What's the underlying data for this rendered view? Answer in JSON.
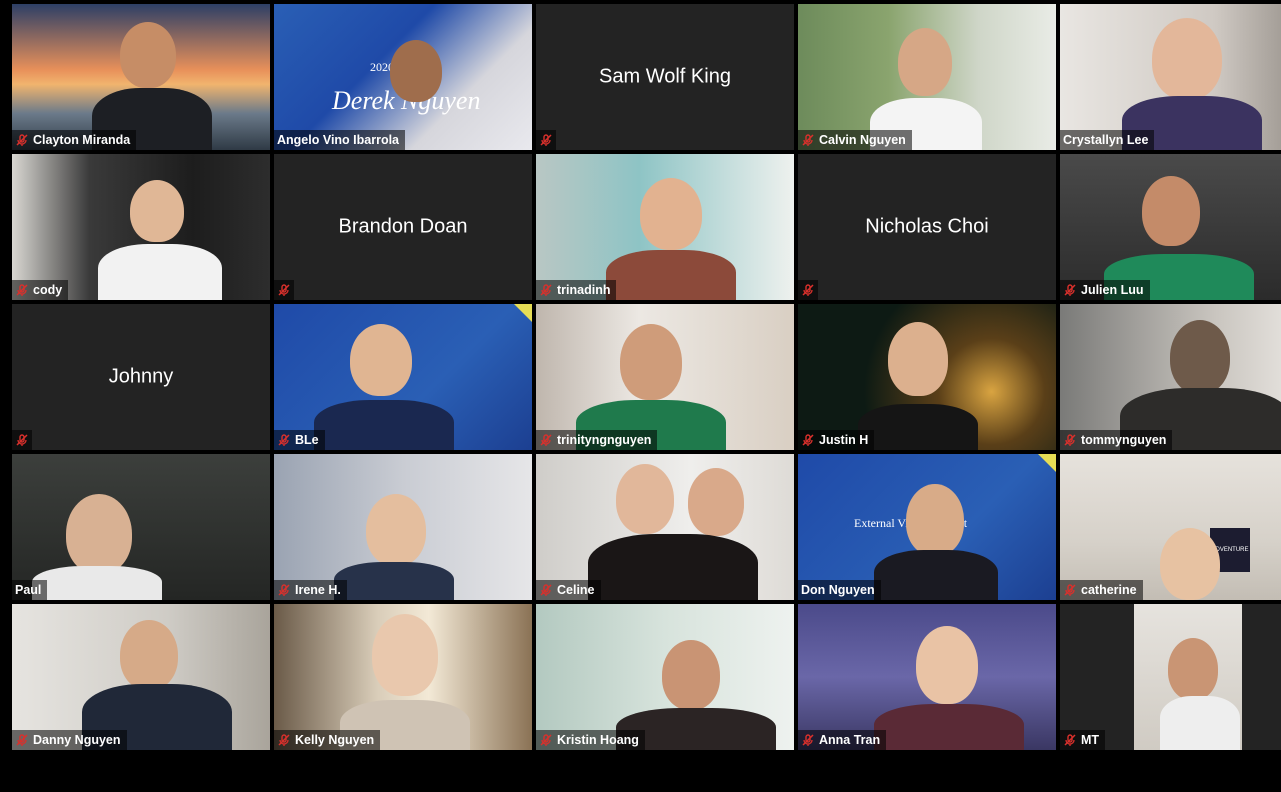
{
  "participants": [
    {
      "name": "Clayton Miranda",
      "video": true
    },
    {
      "name": "Angelo Vino Ibarrola",
      "video": true,
      "active": true
    },
    {
      "name": "Sam Wolf King",
      "video": false
    },
    {
      "name": "Calvin Nguyen",
      "video": true
    },
    {
      "name": "Crystallyn Lee",
      "video": true
    },
    {
      "name": "cody",
      "video": true
    },
    {
      "name": "Brandon Doan",
      "video": false
    },
    {
      "name": "trinadinh",
      "video": true
    },
    {
      "name": "Nicholas Choi",
      "video": false
    },
    {
      "name": "Julien Luu",
      "video": true
    },
    {
      "name": "Johnny",
      "video": false
    },
    {
      "name": "BLe",
      "video": true
    },
    {
      "name": "trinityngnguyen",
      "video": true
    },
    {
      "name": "Justin H",
      "video": true
    },
    {
      "name": "tommynguyen",
      "video": true
    },
    {
      "name": "Paul",
      "video": true
    },
    {
      "name": "Irene H.",
      "video": true
    },
    {
      "name": "Celine",
      "video": true
    },
    {
      "name": "Don Nguyen",
      "video": true
    },
    {
      "name": "catherine",
      "video": true
    },
    {
      "name": "Danny Nguyen",
      "video": true
    },
    {
      "name": "Kelly Nguyen",
      "video": true
    },
    {
      "name": "Kristin Hoang",
      "video": true
    },
    {
      "name": "Anna Tran",
      "video": true
    },
    {
      "name": "MT",
      "video": true
    }
  ],
  "backgrounds": {
    "banner_line_1": "2020-2021",
    "banner_line_2": "External Vice President",
    "banner_script": "Derek Nguyen",
    "poster_text": "ADVENTURE"
  },
  "colors": {
    "active_speaker": "#e6dd55",
    "mute_icon": "#d9302c",
    "tile_bg": "#232323",
    "banner_blue": "#1f4aa8"
  }
}
